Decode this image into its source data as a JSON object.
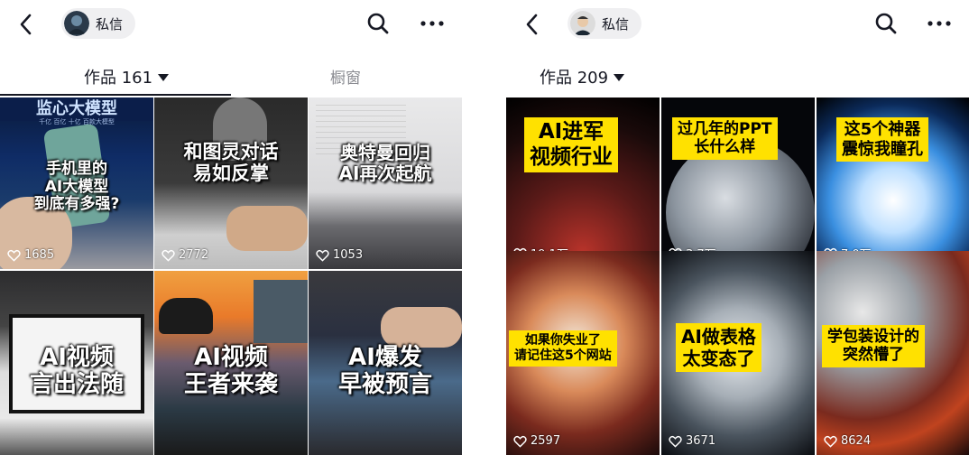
{
  "left": {
    "dm_label": "私信",
    "tabs": [
      {
        "label": "作品 161"
      },
      {
        "label": "橱窗"
      }
    ],
    "banner_text": "监心大模型",
    "banner_sub": "千亿 百亿 十亿 百款大模型",
    "videos": [
      {
        "caption": "手机里的\nAI大模型\n到底有多强?",
        "likes": "1685"
      },
      {
        "caption": "和图灵对话\n易如反掌",
        "likes": "2772"
      },
      {
        "caption": "奥特曼回归\nAI再次起航",
        "likes": "1053"
      },
      {
        "caption": "AI视频\n言出法随",
        "likes": ""
      },
      {
        "caption": "AI视频\n王者来袭",
        "likes": ""
      },
      {
        "caption": "AI爆发\n早被预言",
        "likes": ""
      }
    ]
  },
  "right": {
    "dm_label": "私信",
    "tabs": [
      {
        "label": "作品 209"
      }
    ],
    "videos": [
      {
        "caption": "AI进军\n视频行业",
        "likes": "19.1万"
      },
      {
        "caption": "过几年的PPT\n长什么样",
        "likes": "3.7万"
      },
      {
        "caption": "这5个神器\n震惊我瞳孔",
        "likes": "7.0万"
      },
      {
        "caption": "如果你失业了\n请记住这5个网站",
        "likes": "2597"
      },
      {
        "caption": "AI做表格\n太变态了",
        "likes": "3671"
      },
      {
        "caption": "学包装设计的\n突然懵了",
        "likes": "8624"
      }
    ]
  },
  "icons": {
    "back": "chevron-left-icon",
    "search": "search-icon",
    "more": "more-dots-icon",
    "like": "heart-outline-icon"
  },
  "colors": {
    "caption_box": "#ffe100",
    "pill_bg": "#efeff1",
    "inactive_tab": "#8a8b91"
  }
}
